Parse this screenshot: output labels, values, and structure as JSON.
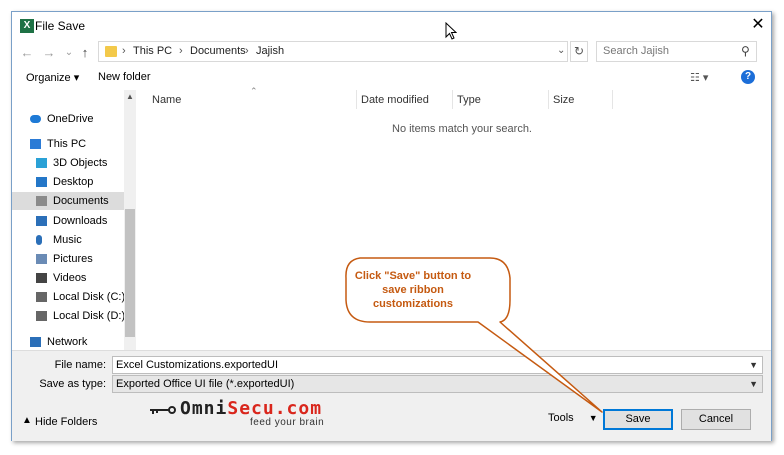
{
  "window": {
    "title": "File Save",
    "close_glyph": "✕"
  },
  "nav": {
    "back": "←",
    "forward": "→",
    "recent": "⌄",
    "up": "↑",
    "refresh": "↻"
  },
  "breadcrumb": [
    "This PC",
    "Documents",
    "Jajish"
  ],
  "breadcrumb_sep": "›",
  "search": {
    "placeholder": "Search Jajish"
  },
  "toolbar": {
    "organize": "Organize ▾",
    "new_folder": "New folder",
    "view": "☷ ▾",
    "help": "?"
  },
  "sidebar": {
    "items": [
      {
        "label": "OneDrive",
        "icon": "cloud-icon",
        "color": "#1e7ad6"
      },
      {
        "label": "This PC",
        "icon": "computer-icon",
        "color": "#2b7bd6"
      },
      {
        "label": "3D Objects",
        "icon": "cube-icon",
        "color": "#2aa1d6"
      },
      {
        "label": "Desktop",
        "icon": "desktop-icon",
        "color": "#2477c8"
      },
      {
        "label": "Documents",
        "icon": "document-icon",
        "color": "#8a8a8a",
        "selected": true
      },
      {
        "label": "Downloads",
        "icon": "download-icon",
        "color": "#2b6fb8"
      },
      {
        "label": "Music",
        "icon": "music-icon",
        "color": "#2b6fb8"
      },
      {
        "label": "Pictures",
        "icon": "pictures-icon",
        "color": "#6a8bb5"
      },
      {
        "label": "Videos",
        "icon": "video-icon",
        "color": "#444444"
      },
      {
        "label": "Local Disk (C:)",
        "icon": "disk-icon",
        "color": "#666666"
      },
      {
        "label": "Local Disk (D:)",
        "icon": "disk-icon",
        "color": "#666666"
      },
      {
        "label": "Network",
        "icon": "network-icon",
        "color": "#2b6fb8"
      }
    ]
  },
  "columns": [
    "Name",
    "Date modified",
    "Type",
    "Size"
  ],
  "empty_message": "No items match your search.",
  "file_name": {
    "label": "File name:",
    "value": "Excel Customizations.exportedUI"
  },
  "save_as_type": {
    "label": "Save as type:",
    "value": "Exported Office UI file (*.exportedUI)"
  },
  "footer": {
    "hide_folders": "Hide Folders",
    "tools": "Tools",
    "save": "Save",
    "cancel": "Cancel"
  },
  "logo": {
    "brand_o": "O",
    "brand_mni": "mni",
    "brand_secu": "Secu.com",
    "tagline": "feed your brain"
  },
  "callout": {
    "text": "Click \"Save\" button to save ribbon customizations"
  },
  "colors": {
    "accent": "#0078d7",
    "callout": "#c55a11",
    "logo_red": "#d9261c",
    "logo_dark": "#222222"
  }
}
